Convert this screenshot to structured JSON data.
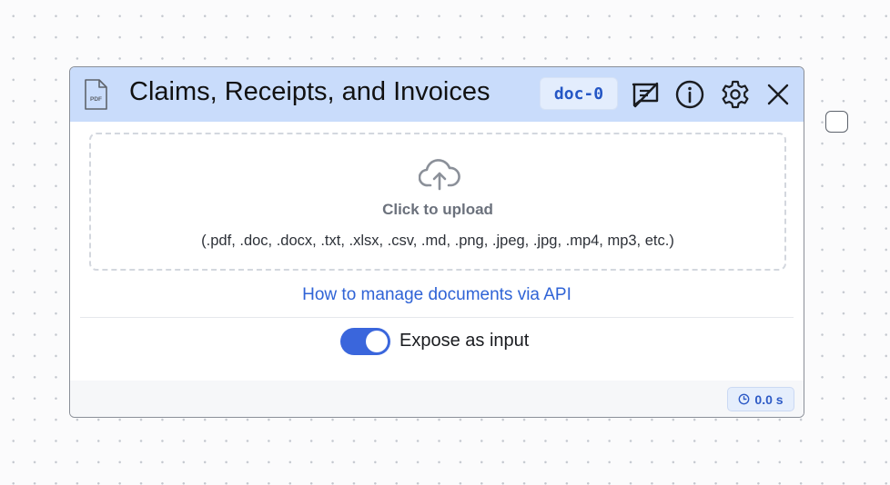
{
  "node": {
    "title": "Claims, Receipts, and Invoices",
    "id_badge": "doc-0",
    "file_icon_text": "PDF",
    "icons": [
      "pdf-file-icon",
      "comment-off-icon",
      "info-icon",
      "gear-icon",
      "close-icon",
      "upload-cloud-icon",
      "clock-icon"
    ],
    "upload": {
      "label": "Click to upload",
      "types": "(.pdf, .doc, .docx, .txt, .xlsx, .csv, .md, .png, .jpeg, .jpg, .mp4, mp3, etc.)"
    },
    "api_link": "How to manage documents via API",
    "expose_toggle": {
      "label": "Expose as input",
      "on": true
    },
    "runtime": "0.0 s"
  },
  "colors": {
    "header_bg": "#c9dcfb",
    "accent": "#3a66dc",
    "link": "#2f63d6"
  }
}
